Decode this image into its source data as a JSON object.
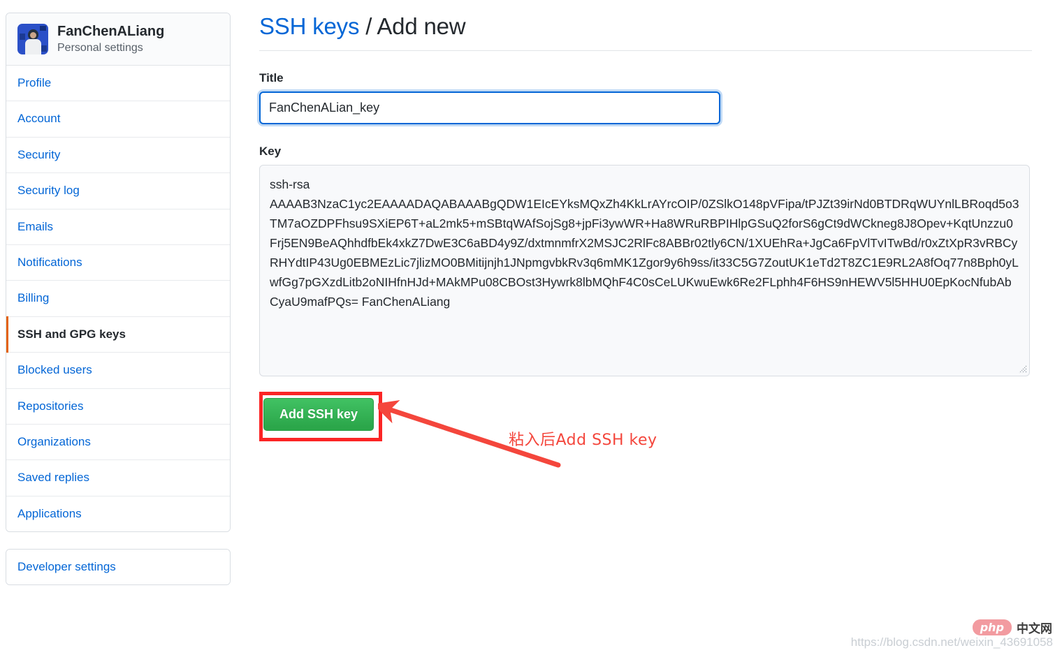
{
  "account": {
    "name": "FanChenALiang",
    "subtitle": "Personal settings",
    "avatar_alt": "user-avatar"
  },
  "sidebar": {
    "items": [
      {
        "label": "Profile",
        "selected": false
      },
      {
        "label": "Account",
        "selected": false
      },
      {
        "label": "Security",
        "selected": false
      },
      {
        "label": "Security log",
        "selected": false
      },
      {
        "label": "Emails",
        "selected": false
      },
      {
        "label": "Notifications",
        "selected": false
      },
      {
        "label": "Billing",
        "selected": false
      },
      {
        "label": "SSH and GPG keys",
        "selected": true
      },
      {
        "label": "Blocked users",
        "selected": false
      },
      {
        "label": "Repositories",
        "selected": false
      },
      {
        "label": "Organizations",
        "selected": false
      },
      {
        "label": "Saved replies",
        "selected": false
      },
      {
        "label": "Applications",
        "selected": false
      }
    ],
    "developer_settings": {
      "label": "Developer settings"
    }
  },
  "header": {
    "breadcrumb_link": "SSH keys",
    "breadcrumb_rest": " / Add new"
  },
  "form": {
    "title_label": "Title",
    "title_value": "FanChenALian_key",
    "title_placeholder": "",
    "key_label": "Key",
    "key_placeholder": "",
    "key_value": "ssh-rsa\nAAAAB3NzaC1yc2EAAAADAQABAAABgQDW1EIcEYksMQxZh4KkLrAYrcOIP/0ZSlkO148pVFipa/tPJZt39irNd0BTDRqWUYnlLBRoqd5o3TM7aOZDPFhsu9SXiEP6T+aL2mk5+mSBtqWAfSojSg8+jpFi3ywWR+Ha8WRuRBPIHlpGSuQ2forS6gCt9dWCkneg8J8Opev+KqtUnzzu0Frj5EN9BeAQhhdfbEk4xkZ7DwE3C6aBD4y9Z/dxtmnmfrX2MSJC2RlFc8ABBr02tly6CN/1XUEhRa+JgCa6FpVlTvITwBd/r0xZtXpR3vRBCyRHYdtIP43Ug0EBMEzLic7jlizMO0BMitijnjh1JNpmgvbkRv3q6mMK1Zgor9y6h9ss/it33C5G7ZoutUK1eTd2T8ZC1E9RL2A8fOq77n8Bph0yLwfGg7pGXzdLitb2oNIHfnHJd+MAkMPu08CBOst3Hywrk8lbMQhF4C0sCeLUKwuEwk6Re2FLphh4F6HS9nHEWV5l5HHU0EpKocNfubAbCyaU9mafPQs= FanChenALiang",
    "submit_label": "Add SSH key"
  },
  "annotations": {
    "callout_text": "粘入后Add SSH key",
    "callout_color": "#f4463c",
    "highlight_color": "#fb2525"
  },
  "watermark": {
    "url": "https://blog.csdn.net/weixin_43691058",
    "logo_text": "php",
    "logo_suffix": "中文网"
  },
  "colors": {
    "link": "#0366d6",
    "accent_selected": "#e36209",
    "button_green": "#2ba64a",
    "text": "#24292e"
  }
}
